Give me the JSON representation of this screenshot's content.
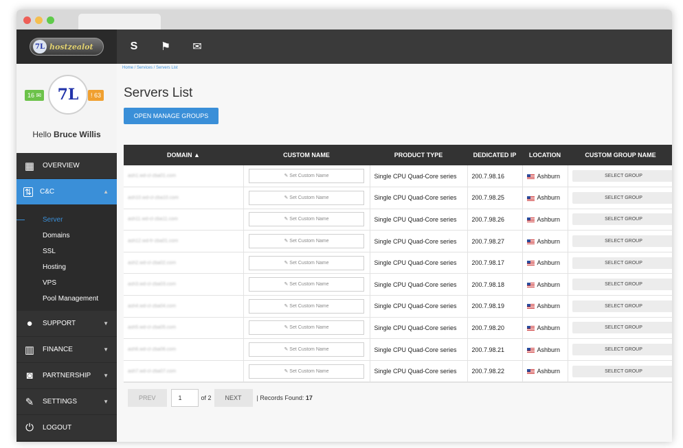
{
  "window": {
    "dots": [
      "#ee5f57",
      "#f4be4f",
      "#5fca4a"
    ]
  },
  "sidebar": {
    "logo_text": "hostzealot",
    "logo_mark": "7L",
    "badge_left": "16 ✉",
    "badge_right": "! 63",
    "hello_prefix": "Hello ",
    "hello_name": "Bruce Willis",
    "items": [
      {
        "label": "OVERVIEW",
        "icon": "grid-icon"
      },
      {
        "label": "C&C",
        "icon": "arrows-icon",
        "active": true
      },
      {
        "label": "SUPPORT",
        "icon": "chat-icon"
      },
      {
        "label": "FINANCE",
        "icon": "server-icon"
      },
      {
        "label": "PARTNERSHIP",
        "icon": "handshake-icon"
      },
      {
        "label": "SETTINGS",
        "icon": "wrench-icon"
      },
      {
        "label": "LOGOUT",
        "icon": "power-icon"
      }
    ],
    "sub_items": [
      "Server",
      "Domains",
      "SSL",
      "Hosting",
      "VPS",
      "Pool Management"
    ]
  },
  "topbar": {
    "icons": [
      "skype-icon",
      "flag-icon",
      "chat-icon"
    ]
  },
  "breadcrumb": "Home / Services / Servers List",
  "page_title": "Servers List",
  "manage_button": "OPEN MANAGE GROUPS",
  "table": {
    "headers": [
      "DOMAIN ▲",
      "CUSTOM NAME",
      "PRODUCT TYPE",
      "DEDICATED IP",
      "LOCATION",
      "CUSTOM GROUP NAME"
    ],
    "custom_name_placeholder": "✎ Set Custom Name",
    "select_group_label": "SELECT GROUP",
    "rows": [
      {
        "domain": "ash1.wd-cl-zba01.com",
        "product": "Single CPU Quad-Core series",
        "ip": "200.7.98.16",
        "location": "Ashburn"
      },
      {
        "domain": "ash10.wd-cl-zba10.com",
        "product": "Single CPU Quad-Core series",
        "ip": "200.7.98.25",
        "location": "Ashburn"
      },
      {
        "domain": "ash11.wd-cl-zba11.com",
        "product": "Single CPU Quad-Core series",
        "ip": "200.7.98.26",
        "location": "Ashburn"
      },
      {
        "domain": "ash12.wd-fr-zba01.com",
        "product": "Single CPU Quad-Core series",
        "ip": "200.7.98.27",
        "location": "Ashburn"
      },
      {
        "domain": "ash2.wd-cl-zba02.com",
        "product": "Single CPU Quad-Core series",
        "ip": "200.7.98.17",
        "location": "Ashburn"
      },
      {
        "domain": "ash3.wd-cl-zba03.com",
        "product": "Single CPU Quad-Core series",
        "ip": "200.7.98.18",
        "location": "Ashburn"
      },
      {
        "domain": "ash4.wd-cl-zba04.com",
        "product": "Single CPU Quad-Core series",
        "ip": "200.7.98.19",
        "location": "Ashburn"
      },
      {
        "domain": "ash5.wd-cl-zba05.com",
        "product": "Single CPU Quad-Core series",
        "ip": "200.7.98.20",
        "location": "Ashburn"
      },
      {
        "domain": "ash6.wd-cl-zba06.com",
        "product": "Single CPU Quad-Core series",
        "ip": "200.7.98.21",
        "location": "Ashburn"
      },
      {
        "domain": "ash7.wd-cl-zba07.com",
        "product": "Single CPU Quad-Core series",
        "ip": "200.7.98.22",
        "location": "Ashburn"
      }
    ]
  },
  "pager": {
    "prev": "PREV",
    "page": "1",
    "of": "of 2",
    "next": "NEXT",
    "records_label": "| Records Found: ",
    "records_count": "17"
  }
}
